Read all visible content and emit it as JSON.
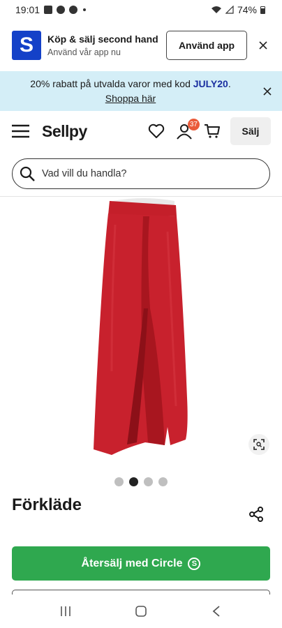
{
  "status_bar": {
    "time": "19:01",
    "battery": "74%"
  },
  "app_banner": {
    "logo_letter": "S",
    "title": "Köp & sälj second hand",
    "subtitle": "Använd vår app nu",
    "button": "Använd app",
    "icons": {
      "close": "close-icon"
    }
  },
  "promo": {
    "text": "20% rabatt på utvalda varor med kod ",
    "code": "JULY20",
    "after_code": ".",
    "link": "Shoppa här"
  },
  "nav": {
    "logo": "Sellpy",
    "cart_badge": "37",
    "sell_label": "Sälj",
    "icons": [
      "menu-icon",
      "heart-icon",
      "user-icon",
      "cart-icon"
    ]
  },
  "search": {
    "placeholder": "Vad vill du handla?"
  },
  "product": {
    "title": "Förkläde",
    "image_count": 4,
    "active_image_index": 1,
    "image_subject": "red apron"
  },
  "cta": {
    "label": "Återsälj med Circle",
    "icon_letter": "S",
    "color": "#2fa84f"
  },
  "colors": {
    "brand_blue": "#1441c8",
    "promo_bg": "#d4eef7",
    "badge": "#ea5b3a",
    "code": "#1a2fa0"
  }
}
